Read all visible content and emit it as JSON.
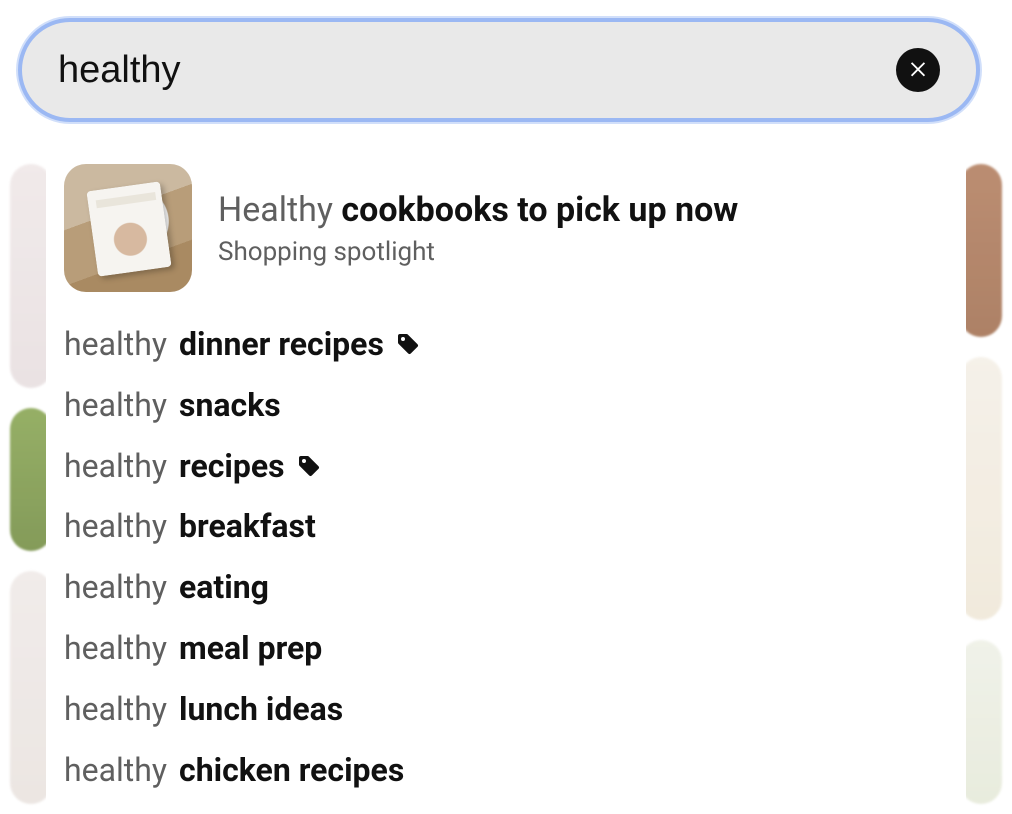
{
  "search": {
    "value": "healthy",
    "clear_icon": "close-icon"
  },
  "spotlight": {
    "prefix": "Healthy",
    "bold": "cookbooks to pick up now",
    "subtitle": "Shopping spotlight",
    "thumb_alt": "cookbook on woven background"
  },
  "suggestions": [
    {
      "prefix": "healthy",
      "bold": "dinner recipes",
      "has_tag": true
    },
    {
      "prefix": "healthy",
      "bold": "snacks",
      "has_tag": false
    },
    {
      "prefix": "healthy",
      "bold": "recipes",
      "has_tag": true
    },
    {
      "prefix": "healthy",
      "bold": "breakfast",
      "has_tag": false
    },
    {
      "prefix": "healthy",
      "bold": "eating",
      "has_tag": false
    },
    {
      "prefix": "healthy",
      "bold": "meal prep",
      "has_tag": false
    },
    {
      "prefix": "healthy",
      "bold": "lunch ideas",
      "has_tag": false
    },
    {
      "prefix": "healthy",
      "bold": "chicken recipes",
      "has_tag": false
    }
  ]
}
